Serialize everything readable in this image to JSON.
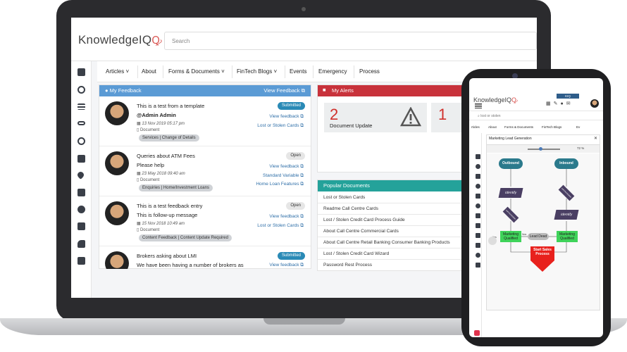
{
  "app": {
    "logo": "KnowledgeIQ",
    "logo_mark": "Ꝙ",
    "search_placeholder": "Search"
  },
  "nav": [
    "Articles",
    "About",
    "Forms & Documents",
    "FinTech Blogs",
    "Events",
    "Emergency",
    "Process"
  ],
  "feedback": {
    "title": "My Feedback",
    "view_link": "View Feedback",
    "items": [
      {
        "title": "This is a test from a template",
        "line2": "@Admin Admin",
        "date": "13 Nov 2019 05:17 pm",
        "type": "Document",
        "tag": "Services | Change of Details",
        "status": "Submitted",
        "link1": "View feedback",
        "link2": "Lost or Stolen Cards"
      },
      {
        "title": "Queries about ATM Fees",
        "line2": "Please help",
        "date": "23 May 2018 09:40 am",
        "type": "Document",
        "tag": "Enquiries | Home/Investment Loans",
        "status": "Open",
        "link1": "View feedback",
        "link2": "Standard Variable",
        "link3": "Home Loan Features"
      },
      {
        "title": "This is a test feedback entry",
        "line2": "This is follow-up message",
        "date": "15 Nov 2018 10:49 am",
        "type": "Document",
        "tag": "Content Feedback | Content Update Required",
        "status": "Open",
        "link1": "View feedback",
        "link2": "Lost or Stolen Cards"
      },
      {
        "title": "Brokers asking about LMI",
        "line2": "We have been having a number of brokers as",
        "status": "Submitted",
        "link1": "View feedback"
      }
    ]
  },
  "alerts": {
    "title": "My Alerts",
    "count1": "2",
    "label1": "Document Update",
    "count2": "1"
  },
  "popular": {
    "title": "Popular Documents",
    "items": [
      "Lost or Stolen Cards",
      "Readme Call Centre Cards",
      "Lost / Stolen Credit Card Process Guide",
      "About Call Centre Commercial Cards",
      "About Call Centre Retail Banking Consumer Banking Products",
      "Lost / Stolen Credit Card Wizard",
      "Password Rest Process"
    ]
  },
  "mobile": {
    "logo": "KnowledgeIQ",
    "badge": "KIQ",
    "search_placeholder": "lost or stolen",
    "nav": [
      "rticles",
      "About",
      "Forms & Documents",
      "FinTech Blogs",
      "Ev"
    ],
    "doc_title": "Marketing Lead Generation",
    "zoom": "72 %",
    "flow": {
      "outbound": "Outbound",
      "inbound": "Inbound",
      "identify": "Identify",
      "communication": "communication",
      "identify2": "Identify",
      "mq1": "Marketing Qualified",
      "lead_dead": "Lead Dead",
      "mq2": "Marketing Qualified",
      "start_sales": "Start Sales Process",
      "yes": "Yes",
      "no": "Nos"
    }
  },
  "colors": {
    "feedback_header": "#5b9bd5",
    "alerts_header": "#c8323b",
    "popular_header": "#24a29a",
    "flow_teal": "#2b7a8c",
    "flow_purple": "#4a3f63",
    "flow_green": "#3fd35a",
    "flow_red": "#e8211d"
  },
  "icons": [
    "dashboard-icon",
    "search-icon",
    "menu-icon",
    "link-icon",
    "globe-icon",
    "calendar-icon",
    "heart-icon",
    "save-icon",
    "alert-icon",
    "comment-icon",
    "tools-icon",
    "chat-icon",
    "warning-icon"
  ]
}
